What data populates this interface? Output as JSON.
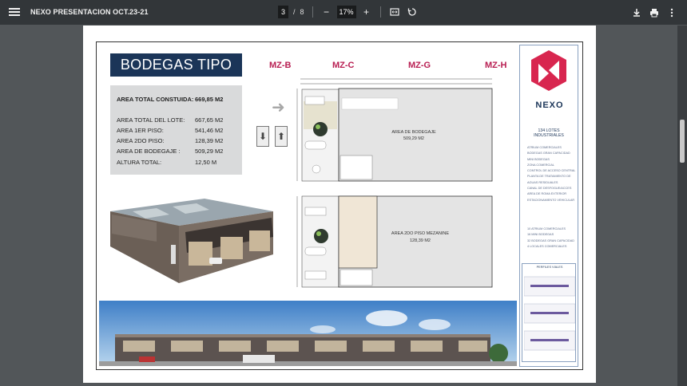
{
  "toolbar": {
    "title": "NEXO PRESENTACION OCT.23-21",
    "current_page": "3",
    "page_separator": "/",
    "total_pages": "8",
    "zoom": "17%",
    "zoom_out": "−",
    "zoom_in": "+"
  },
  "sheet": {
    "title": "BODEGAS TIPO",
    "mz_labels": [
      "MZ-B",
      "MZ-C",
      "MZ-G",
      "MZ-H"
    ],
    "areas": [
      {
        "label": "AREA TOTAL CONSTUIDA:",
        "value": "669,85 M2"
      },
      {
        "label": "AREA TOTAL DEL LOTE:",
        "value": "667,65 M2"
      },
      {
        "label": "AREA 1ER PISO:",
        "value": "541,46 M2"
      },
      {
        "label": "AREA 2DO PISO:",
        "value": "128,39 M2"
      },
      {
        "label": "AREA DE BODEGAJE :",
        "value": "509,29 M2"
      },
      {
        "label": "ALTURA TOTAL:",
        "value": "12,50 M"
      }
    ],
    "plan1": {
      "label": "AREA DE BODEGAJE",
      "value": "509,29 M2"
    },
    "plan2": {
      "label": "AREA 2DO PISO MEZANINE",
      "value": "128,39 M2"
    },
    "brand": "NEXO",
    "lotes": "134 LOTES INDUSTRIALES",
    "side_list_a": [
      "ATRIUM COMERCIALES",
      "BODEGAS GRAN CAPACIDAD",
      "MINI BODEGAS",
      "ZONA COMERCIAL",
      "CONTROL DE ACCESO CENTRAL",
      "PLANTA DE TRATAMIENTO DE",
      "AGUAS RESIDUALES",
      "CANAL DE DESFOGUE/ACCES",
      "AREA DE ROMA EXTERIOR",
      "ESTACIONAMIENTO VEHICULAR"
    ],
    "side_list_b": [
      "10 ATRIUM COMERCIALES",
      "16 MINI BODEGAS",
      "32 BODEGAS GRAN CAPACIDAD",
      "4 LOCALES COMERCIALES"
    ],
    "perfiles": "PERFILES VIALES"
  },
  "colors": {
    "accent": "#b81e52",
    "navy": "#1b3558",
    "toolbar": "#323639"
  }
}
